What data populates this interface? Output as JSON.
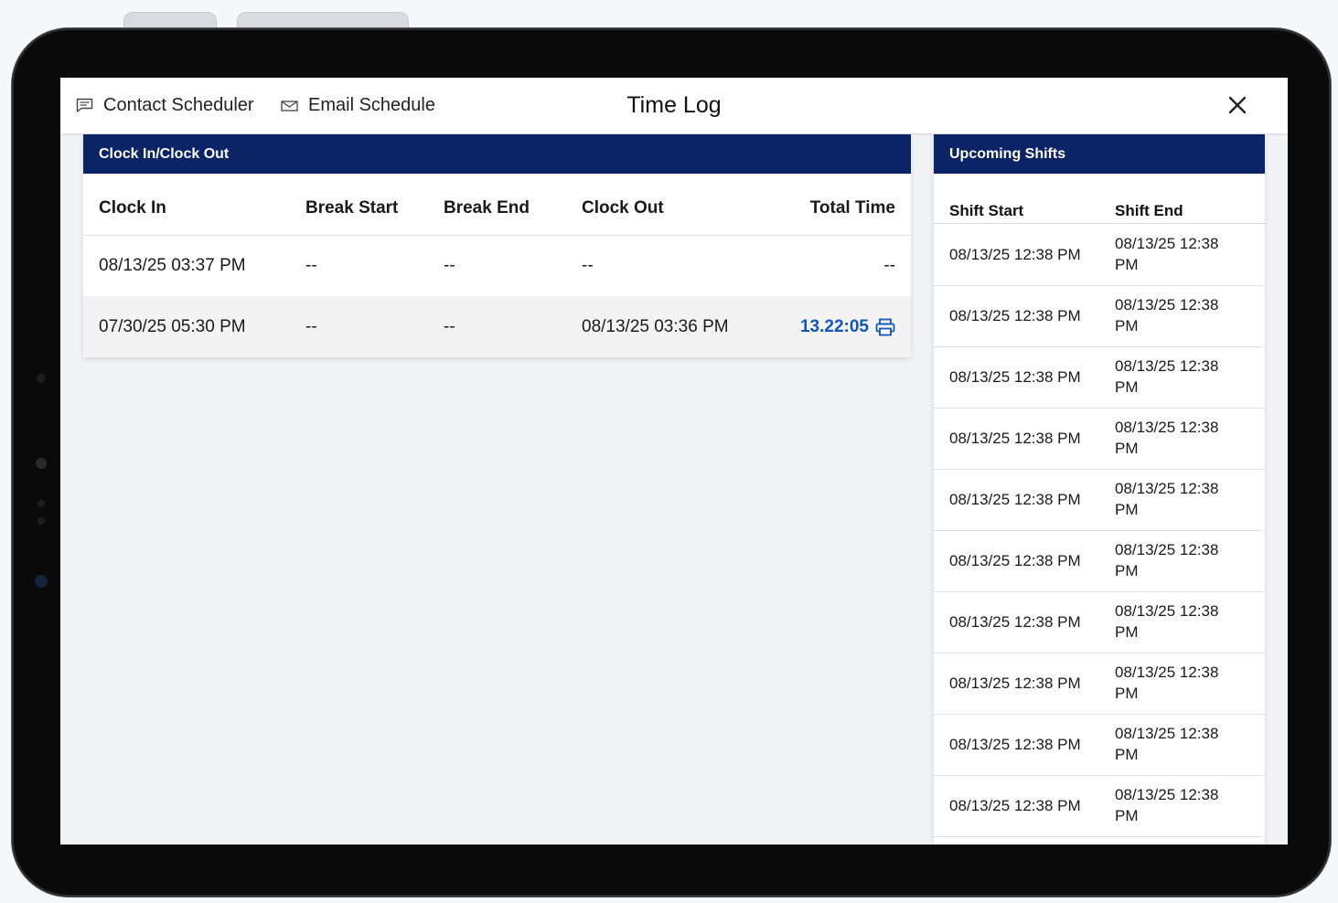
{
  "header": {
    "contact_label": "Contact Scheduler",
    "email_label": "Email Schedule",
    "title": "Time Log"
  },
  "clock_panel": {
    "title": "Clock In/Clock Out",
    "columns": [
      "Clock In",
      "Break Start",
      "Break End",
      "Clock Out",
      "Total Time"
    ],
    "rows": [
      {
        "clock_in": "08/13/25 03:37 PM",
        "break_start": "--",
        "break_end": "--",
        "clock_out": "--",
        "total": "--"
      },
      {
        "clock_in": "07/30/25 05:30 PM",
        "break_start": "--",
        "break_end": "--",
        "clock_out": "08/13/25 03:36 PM",
        "total": "13.22:05"
      }
    ]
  },
  "shifts_panel": {
    "title": "Upcoming Shifts",
    "columns": [
      "Shift Start",
      "Shift End"
    ],
    "rows": [
      {
        "start": "08/13/25 12:38 PM",
        "end": "08/13/25 12:38 PM"
      },
      {
        "start": "08/13/25 12:38 PM",
        "end": "08/13/25 12:38 PM"
      },
      {
        "start": "08/13/25 12:38 PM",
        "end": "08/13/25 12:38 PM"
      },
      {
        "start": "08/13/25 12:38 PM",
        "end": "08/13/25 12:38 PM"
      },
      {
        "start": "08/13/25 12:38 PM",
        "end": "08/13/25 12:38 PM"
      },
      {
        "start": "08/13/25 12:38 PM",
        "end": "08/13/25 12:38 PM"
      },
      {
        "start": "08/13/25 12:38 PM",
        "end": "08/13/25 12:38 PM"
      },
      {
        "start": "08/13/25 12:38 PM",
        "end": "08/13/25 12:38 PM"
      },
      {
        "start": "08/13/25 12:38 PM",
        "end": "08/13/25 12:38 PM"
      },
      {
        "start": "08/13/25 12:38 PM",
        "end": "08/13/25 12:38 PM"
      }
    ]
  },
  "icons": {
    "contact": "message-icon",
    "email": "envelope-icon",
    "close": "close-icon",
    "print": "printer-icon"
  },
  "colors": {
    "header_bar": "#0b2466",
    "link": "#1257b8"
  }
}
